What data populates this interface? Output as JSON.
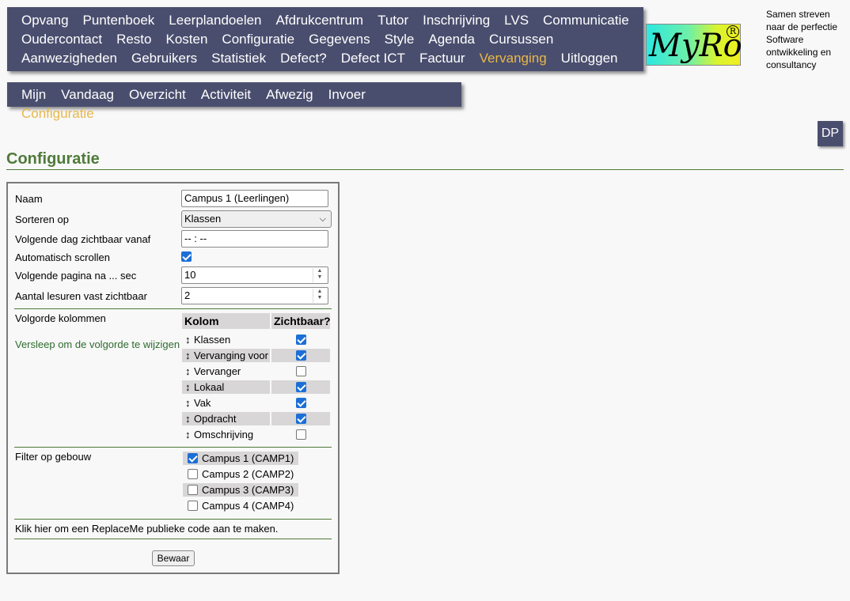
{
  "main_menu": {
    "rows": [
      [
        {
          "label": "Opvang"
        },
        {
          "label": "Puntenboek"
        },
        {
          "label": "Leerplandoelen"
        },
        {
          "label": "Afdrukcentrum"
        },
        {
          "label": "Tutor"
        },
        {
          "label": "Inschrijving"
        },
        {
          "label": "LVS"
        },
        {
          "label": "Communicatie"
        }
      ],
      [
        {
          "label": "Oudercontact"
        },
        {
          "label": "Resto"
        },
        {
          "label": "Kosten"
        },
        {
          "label": "Configuratie"
        },
        {
          "label": "Gegevens"
        },
        {
          "label": "Style"
        },
        {
          "label": "Agenda"
        },
        {
          "label": "Cursussen"
        }
      ],
      [
        {
          "label": "Aanwezigheden"
        },
        {
          "label": "Gebruikers"
        },
        {
          "label": "Statistiek"
        },
        {
          "label": "Defect?"
        },
        {
          "label": "Defect ICT"
        },
        {
          "label": "Factuur"
        },
        {
          "label": "Vervanging",
          "active": true
        },
        {
          "label": "Uitloggen"
        }
      ]
    ]
  },
  "sub_menu": {
    "items": [
      {
        "label": "Mijn"
      },
      {
        "label": "Vandaag"
      },
      {
        "label": "Overzicht"
      },
      {
        "label": "Activiteit"
      },
      {
        "label": "Afwezig"
      },
      {
        "label": "Invoer"
      },
      {
        "label": "Configuratie",
        "active": true
      }
    ]
  },
  "logo": {
    "text": "MyRo",
    "reg": "R"
  },
  "slogan": "Samen streven naar de perfectie Software ontwikkeling en consultancy",
  "user_initials": "DP",
  "page_title": "Configuratie",
  "colors": {
    "menu_bg": "#4a4e6e",
    "active": "#e8b84a",
    "title_green": "#4f7a3a",
    "checkbox": "#1b6fd6"
  },
  "form": {
    "naam_label": "Naam",
    "naam_value": "Campus 1 (Leerlingen)",
    "sorteren_label": "Sorteren op",
    "sorteren_value": "Klassen",
    "volgende_dag_label": "Volgende dag zichtbaar vanaf",
    "volgende_dag_value": "-- : --",
    "auto_scroll_label": "Automatisch scrollen",
    "auto_scroll_checked": true,
    "volgende_pagina_label": "Volgende pagina na ... sec",
    "volgende_pagina_value": "10",
    "lesuren_label": "Aantal lesuren vast zichtbaar",
    "lesuren_value": "2",
    "volgorde_label": "Volgorde kolommen",
    "volgorde_hint": "Versleep om de volgorde te wijzigen",
    "col_header_kolom": "Kolom",
    "col_header_zichtbaar": "Zichtbaar?",
    "arrow_icon": "↕",
    "columns": [
      {
        "name": "Klassen",
        "visible": true
      },
      {
        "name": "Vervanging voor",
        "visible": true
      },
      {
        "name": "Vervanger",
        "visible": false
      },
      {
        "name": "Lokaal",
        "visible": true
      },
      {
        "name": "Vak",
        "visible": true
      },
      {
        "name": "Opdracht",
        "visible": true
      },
      {
        "name": "Omschrijving",
        "visible": false
      }
    ],
    "filter_label": "Filter op gebouw",
    "buildings": [
      {
        "name": "Campus 1 (CAMP1)",
        "checked": true
      },
      {
        "name": "Campus 2 (CAMP2)",
        "checked": false
      },
      {
        "name": "Campus 3 (CAMP3)",
        "checked": false
      },
      {
        "name": "Campus 4 (CAMP4)",
        "checked": false
      }
    ],
    "public_code_link": "Klik hier om een ReplaceMe publieke code aan te maken.",
    "save_label": "Bewaar"
  }
}
